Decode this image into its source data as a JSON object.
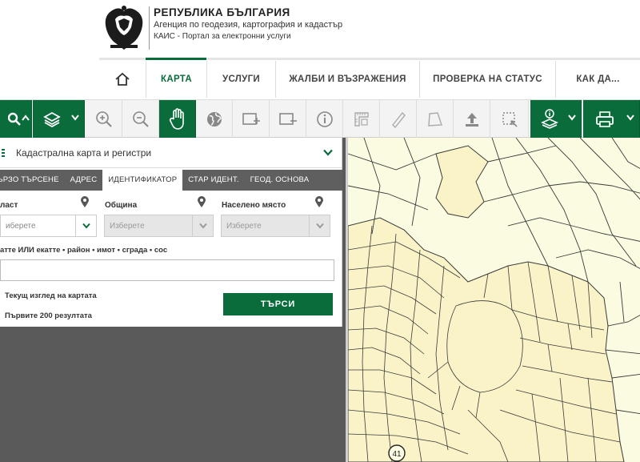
{
  "header": {
    "title": "РЕПУБЛИКА БЪЛГАРИЯ",
    "agency": "Агенция по геодезия, картография и кадастър",
    "portal": "КАИС - Портал за електронни услуги"
  },
  "nav": {
    "items": [
      {
        "label": "КАРТА",
        "active": true
      },
      {
        "label": "УСЛУГИ"
      },
      {
        "label": "ЖАЛБИ И ВЪЗРАЖЕНИЯ"
      },
      {
        "label": "ПРОВЕРКА НА СТАТУС"
      },
      {
        "label": "КАК ДА..."
      }
    ]
  },
  "panel": {
    "layer": "Кадастрална карта и регистри",
    "tabs": [
      {
        "label": "ЪРЗО ТЪРСЕНЕ"
      },
      {
        "label": "АДРЕС"
      },
      {
        "label": "ИДЕНТИФИКАТОР",
        "active": true
      },
      {
        "label": "СТАР ИДЕНТ."
      },
      {
        "label": "ГЕОД. ОСНОВА"
      }
    ],
    "oblast_label": "ласт",
    "obshtina_label": "Община",
    "naseleno_label": "Населено място",
    "oblast_placeholder": "иберете",
    "obshtina_placeholder": "Изберете",
    "naseleno_placeholder": "Изберете",
    "identifier_label": "атте ИЛИ екатте • район • имот • сграда • сос",
    "current_view": "Текущ изглед на картата",
    "first_results": "Първите 200 резултата",
    "search_button": "ТЪРСИ"
  },
  "map": {
    "label": "41"
  },
  "colors": {
    "accent": "#0a6b3b",
    "map_bg": "#fafbe0",
    "map_fill": "#faf3c8",
    "map_line": "#3a3a3a"
  }
}
